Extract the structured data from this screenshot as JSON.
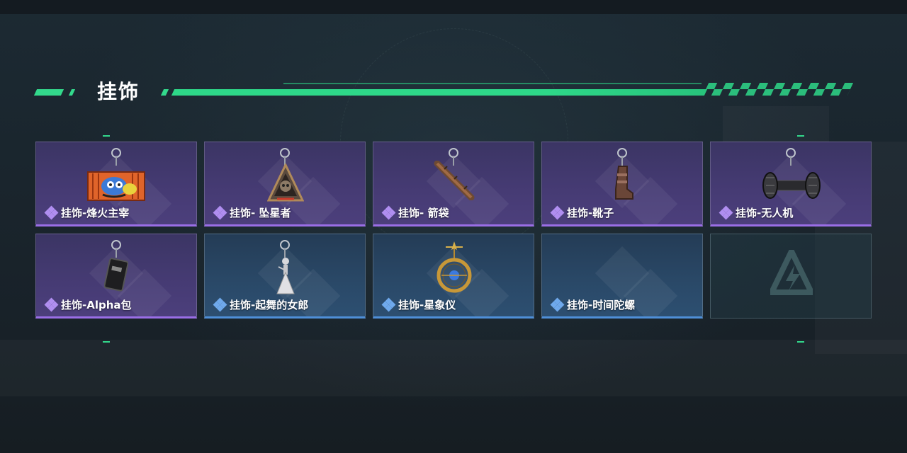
{
  "section": {
    "title": "挂饰",
    "accent_color": "#2ed889"
  },
  "rarity_colors": {
    "purple": "#9a6ee6",
    "blue": "#4f8fd8"
  },
  "items": [
    {
      "label": "挂饰-烽火主宰",
      "rarity": "purple",
      "icon": "graffiti-container-charm-icon"
    },
    {
      "label": "挂饰- 坠星者",
      "rarity": "purple",
      "icon": "triangle-skull-charm-icon"
    },
    {
      "label": "挂饰- 箭袋",
      "rarity": "purple",
      "icon": "quiver-charm-icon"
    },
    {
      "label": "挂饰-靴子",
      "rarity": "purple",
      "icon": "boot-charm-icon"
    },
    {
      "label": "挂饰-无人机",
      "rarity": "purple",
      "icon": "drone-charm-icon"
    },
    {
      "label": "挂饰-Alpha包",
      "rarity": "purple",
      "icon": "alpha-pack-charm-icon"
    },
    {
      "label": "挂饰-起舞的女郎",
      "rarity": "blue",
      "icon": "dancing-lady-charm-icon"
    },
    {
      "label": "挂饰-星象仪",
      "rarity": "blue",
      "icon": "astrolabe-charm-icon"
    },
    {
      "label": "挂饰-时间陀螺",
      "rarity": "blue",
      "icon": "time-top-charm-icon"
    },
    {
      "label": "",
      "rarity": "empty",
      "icon": "delta-logo-icon"
    }
  ]
}
